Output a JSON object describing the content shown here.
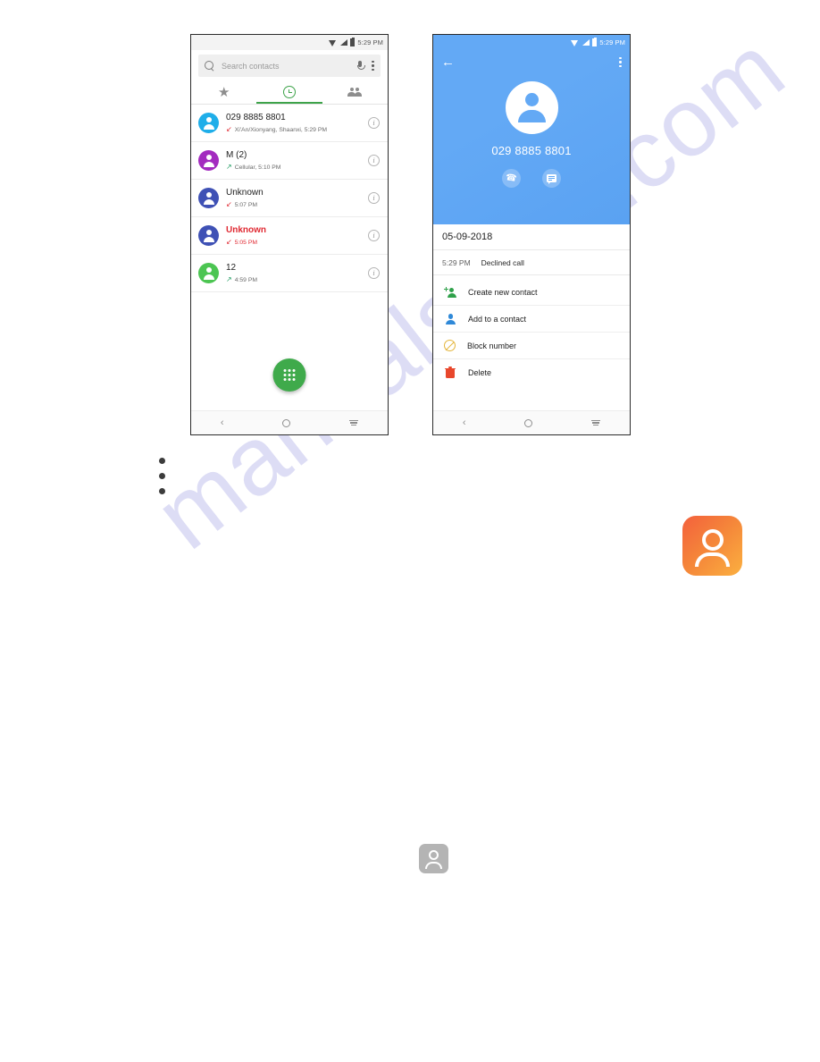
{
  "watermark": {
    "text": "manualshive.com"
  },
  "phone_left": {
    "status_bar": {
      "time": "5:29 PM",
      "icons": [
        "wifi-icon",
        "signal-icon",
        "battery-icon"
      ]
    },
    "search": {
      "placeholder": "Search contacts",
      "search_icon": "search-icon",
      "mic_icon": "microphone-icon",
      "overflow_icon": "overflow-menu-icon"
    },
    "tabs": [
      {
        "id": "favorites",
        "icon": "star-icon",
        "active": false
      },
      {
        "id": "recents",
        "icon": "clock-icon",
        "active": true
      },
      {
        "id": "contacts",
        "icon": "people-icon",
        "active": false
      }
    ],
    "accent_color": "#3EA34A",
    "call_log": [
      {
        "name": "029 8885 8801",
        "detail": "Xi'An/Xionyang, Shaanxi, 5:29 PM",
        "direction": "incoming",
        "arrow": "↙",
        "missed": false,
        "avatar_color": "#1FAEE9"
      },
      {
        "name": "M (2)",
        "detail": "Cellular, 5:10 PM",
        "direction": "outgoing",
        "arrow": "↗",
        "missed": false,
        "avatar_color": "#A32BBF"
      },
      {
        "name": "Unknown",
        "detail": "5:07 PM",
        "direction": "incoming",
        "arrow": "↙",
        "missed": false,
        "avatar_color": "#3F51B5"
      },
      {
        "name": "Unknown",
        "detail": "5:05 PM",
        "direction": "incoming",
        "arrow": "↙",
        "missed": true,
        "avatar_color": "#3F51B5"
      },
      {
        "name": "12",
        "detail": "4:59 PM",
        "direction": "outgoing",
        "arrow": "↗",
        "missed": false,
        "avatar_color": "#4CC552"
      }
    ],
    "fab": {
      "icon": "dialpad-icon",
      "color": "#3FAA4B"
    },
    "nav_bar": [
      "back-icon",
      "home-icon",
      "recents-icon"
    ]
  },
  "phone_right": {
    "status_bar": {
      "time": "5:29 PM",
      "icons": [
        "wifi-icon",
        "signal-icon",
        "battery-icon"
      ]
    },
    "header": {
      "back_icon": "back-arrow-icon",
      "overflow_icon": "overflow-menu-icon",
      "avatar_icon": "person-avatar-icon",
      "number": "029 8885 8801",
      "background_color": "#63A9F5",
      "actions": [
        {
          "id": "call",
          "icon": "phone-icon"
        },
        {
          "id": "message",
          "icon": "message-icon"
        }
      ]
    },
    "date": "05-09-2018",
    "entry": {
      "time": "5:29 PM",
      "label": "Declined call"
    },
    "menu": [
      {
        "label": "Create new contact",
        "icon": "person-add-icon",
        "color": "#2FA14A"
      },
      {
        "label": "Add to a contact",
        "icon": "person-icon",
        "color": "#2F89D8"
      },
      {
        "label": "Block number",
        "icon": "block-icon",
        "color": "#E4B53C"
      },
      {
        "label": "Delete",
        "icon": "trash-icon",
        "color": "#E8472C"
      }
    ],
    "nav_bar": [
      "back-icon",
      "home-icon",
      "recents-icon"
    ]
  },
  "app_icons": {
    "contacts_orange": {
      "icon": "contacts-app-icon",
      "color_start": "#F3603C",
      "color_end": "#FBB040"
    },
    "contacts_gray": {
      "icon": "contacts-app-icon",
      "color": "#B4B4B4"
    }
  },
  "bullets": {
    "count": 3
  }
}
